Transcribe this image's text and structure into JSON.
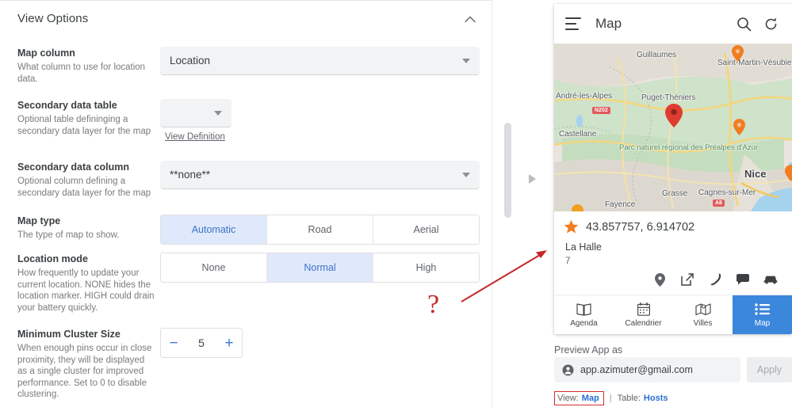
{
  "settings_panel": {
    "section_title": "View Options",
    "collapse_icon": "chevron-up-icon",
    "options": [
      {
        "label": "Map column",
        "description": "What column to use for location data.",
        "control": "dropdown",
        "value": "Location"
      },
      {
        "label": "Secondary data table",
        "description": "Optional table defininging a secondary data layer for the map",
        "control": "dropdown",
        "value": "",
        "link": "View Definition"
      },
      {
        "label": "Secondary data column",
        "description": "Optional column defining a secondary data layer for the map",
        "control": "dropdown",
        "value": "**none**"
      },
      {
        "label": "Map type",
        "description": "The type of map to show.",
        "control": "segmented",
        "choices": [
          "Automatic",
          "Road",
          "Aerial"
        ],
        "selected": "Automatic"
      },
      {
        "label": "Location mode",
        "description": "How frequently to update your current location. NONE hides the location marker. HIGH could drain your battery quickly.",
        "control": "segmented",
        "choices": [
          "None",
          "Normal",
          "High"
        ],
        "selected": "Normal"
      },
      {
        "label": "Minimum Cluster Size",
        "description": "When enough pins occur in close proximity, they will be displayed as a single cluster for improved performance. Set to 0 to disable clustering.",
        "control": "stepper",
        "value": "5",
        "decrement": "−",
        "increment": "+"
      }
    ]
  },
  "preview": {
    "app_bar": {
      "menu_icon": "hamburger-menu-icon",
      "title": "Map",
      "search_icon": "search-icon",
      "refresh_icon": "refresh-icon"
    },
    "map": {
      "labels": [
        {
          "text": "Guillaumes",
          "kind": "city"
        },
        {
          "text": "Saint-Martin-Vésubie",
          "kind": "city"
        },
        {
          "text": "André-les-Alpes",
          "kind": "city"
        },
        {
          "text": "Puget-Théniers",
          "kind": "city"
        },
        {
          "text": "Castellane",
          "kind": "city"
        },
        {
          "text": "Nice",
          "kind": "big"
        },
        {
          "text": "Grasse",
          "kind": "city"
        },
        {
          "text": "Cagnes-sur-Mer",
          "kind": "city"
        },
        {
          "text": "Fayence",
          "kind": "city"
        }
      ],
      "park_label": "Parc naturel régional des Préalpes d'Azur",
      "road_badges": [
        "N202",
        "A8"
      ],
      "selected_marker": "red-map-pin",
      "other_markers": "orange-star-pins"
    },
    "detail": {
      "star_icon": "star-icon",
      "coordinates": "43.857757, 6.914702",
      "name": "La Halle",
      "sub": "7",
      "actions": [
        "location-pin-icon",
        "external-link-icon",
        "phone-icon",
        "chat-icon",
        "car-icon"
      ]
    },
    "bottom_nav": [
      {
        "label": "Agenda",
        "icon": "book-icon",
        "active": false
      },
      {
        "label": "Calendrier",
        "icon": "calendar-icon",
        "active": false
      },
      {
        "label": "Villes",
        "icon": "map-fold-icon",
        "active": false
      },
      {
        "label": "Map",
        "icon": "list-icon",
        "active": true
      }
    ],
    "preview_as": {
      "label": "Preview App as",
      "account_icon": "account-circle-icon",
      "email": "app.azimuter@gmail.com",
      "apply_label": "Apply"
    },
    "status": {
      "view_label": "View:",
      "view_value": "Map",
      "separator": "|",
      "table_label": "Table:",
      "table_value": "Hosts"
    }
  },
  "annotation": {
    "question_mark": "?",
    "arrow": "red-arrow"
  },
  "colors": {
    "accent_blue": "#3b87dc",
    "segment_active_bg": "#dfe9fb",
    "segment_active_text": "#3f72c7",
    "annotation_red": "#c62828",
    "link_blue": "#2a6fd4",
    "marker_red": "#df3b30",
    "marker_orange": "#f07d20"
  }
}
